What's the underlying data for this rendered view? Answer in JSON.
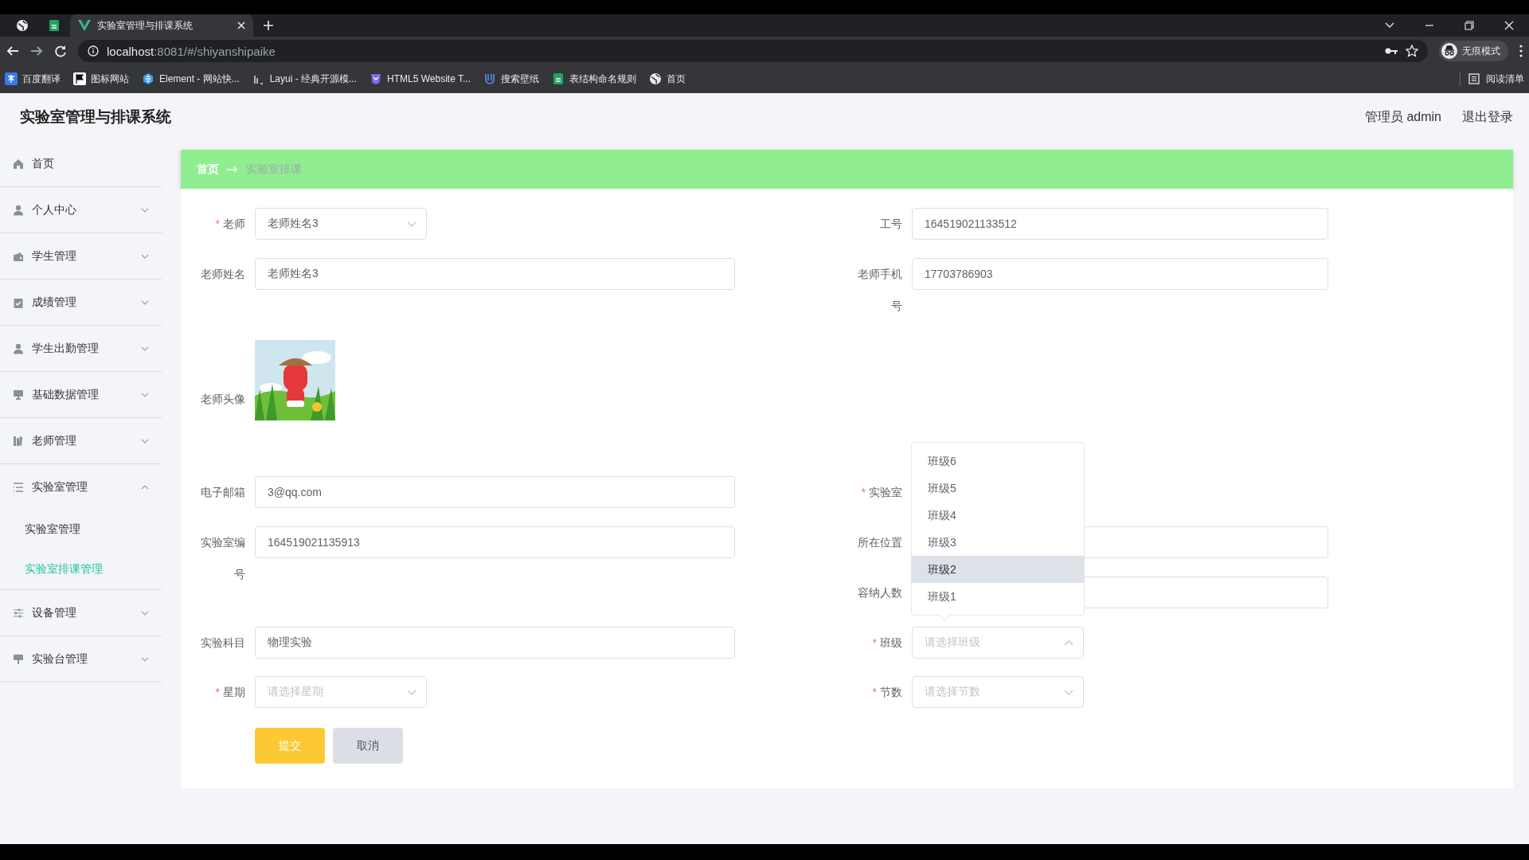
{
  "browser": {
    "tabs": [
      {
        "title": "实验室管理与排课系统",
        "selected": true
      }
    ],
    "url": {
      "host": "localhost",
      "path": ":8081/#/shiyanshipaike"
    },
    "profile": "无痕模式",
    "bookmarks": [
      {
        "label": "百度翻译",
        "kind": "translate"
      },
      {
        "label": "图标网站",
        "kind": "flag"
      },
      {
        "label": "Element - 网站快...",
        "kind": "hexagon"
      },
      {
        "label": "Layui - 经典开源模...",
        "kind": "bars"
      },
      {
        "label": "HTML5 Website T...",
        "kind": "shield"
      },
      {
        "label": "搜索壁纸",
        "kind": "fork"
      },
      {
        "label": "表结构命名规则",
        "kind": "sheet"
      },
      {
        "label": "首页",
        "kind": "globe"
      }
    ],
    "reading_list": "阅读清单"
  },
  "app": {
    "title": "实验室管理与排课系统",
    "user": "管理员 admin",
    "logout": "退出登录"
  },
  "sidebar": {
    "items": [
      {
        "label": "首页",
        "kind": "link"
      },
      {
        "label": "个人中心",
        "kind": "submenu",
        "expanded": false
      },
      {
        "label": "学生管理",
        "kind": "submenu",
        "expanded": false
      },
      {
        "label": "成绩管理",
        "kind": "submenu",
        "expanded": false
      },
      {
        "label": "学生出勤管理",
        "kind": "submenu",
        "expanded": false
      },
      {
        "label": "基础数据管理",
        "kind": "submenu",
        "expanded": false
      },
      {
        "label": "老师管理",
        "kind": "submenu",
        "expanded": false
      },
      {
        "label": "实验室管理",
        "kind": "submenu",
        "expanded": true,
        "children": [
          {
            "label": "实验室管理",
            "selected": false
          },
          {
            "label": "实验室排课管理",
            "selected": true
          }
        ]
      },
      {
        "label": "设备管理",
        "kind": "submenu",
        "expanded": false
      },
      {
        "label": "实验台管理",
        "kind": "submenu",
        "expanded": false
      }
    ]
  },
  "breadcrumb": [
    {
      "label": "首页",
      "current": false
    },
    {
      "label": "实验室排课",
      "current": true
    }
  ],
  "form": {
    "rows": [
      {
        "left": {
          "label": "老师",
          "required_mark": "*",
          "kind": "select",
          "value": "老师姓名3"
        },
        "right": {
          "label": "工号",
          "kind": "input",
          "value": "164519021133512"
        }
      },
      {
        "left": {
          "label": "老师姓名",
          "kind": "input",
          "value": "老师姓名3"
        },
        "right": {
          "label": "老师手机号",
          "kind": "input",
          "value": "17703786903"
        }
      },
      {
        "left": {
          "label": "老师头像"
        }
      },
      {
        "left": {
          "label": "电子邮箱",
          "kind": "input",
          "value": "3@qq.com"
        },
        "right": {
          "label": "实验室",
          "required_mark": "*",
          "kind": "covered"
        }
      },
      {
        "left": {
          "label": "实验室编号",
          "kind": "input",
          "value": "164519021135913"
        },
        "right": {
          "label": "所在位置",
          "kind": "input"
        }
      },
      {
        "right": {
          "label": "容纳人数",
          "kind": "input"
        }
      },
      {
        "left": {
          "label": "实验科目",
          "kind": "input",
          "value": "物理实验"
        },
        "right": {
          "label": "班级",
          "required_mark": "*",
          "kind": "select",
          "placeholder": "请选择班级",
          "open": true,
          "options": [
            {
              "label": "班级6",
              "hovered": false
            },
            {
              "label": "班级5",
              "hovered": false
            },
            {
              "label": "班级4",
              "hovered": false
            },
            {
              "label": "班级3",
              "hovered": false
            },
            {
              "label": "班级2",
              "hovered": true
            },
            {
              "label": "班级1",
              "hovered": false
            }
          ]
        }
      },
      {
        "left": {
          "label": "星期",
          "required_mark": "*",
          "kind": "select",
          "placeholder": "请选择星期"
        },
        "right": {
          "label": "节数",
          "required_mark": "*",
          "kind": "select",
          "placeholder": "请选择节数"
        }
      }
    ],
    "buttons": [
      {
        "label": "提交",
        "kind": "primary"
      },
      {
        "label": "取消",
        "kind": "default"
      }
    ]
  }
}
